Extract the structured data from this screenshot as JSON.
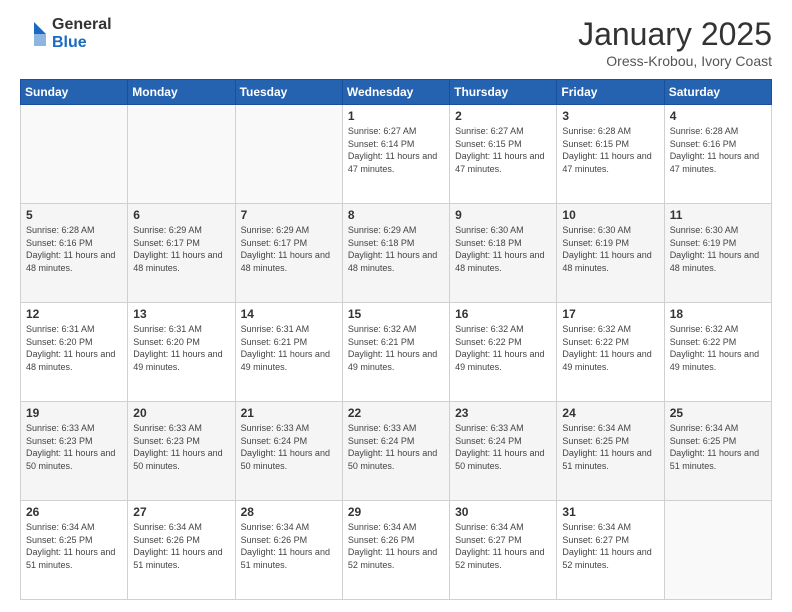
{
  "header": {
    "logo_general": "General",
    "logo_blue": "Blue",
    "title": "January 2025",
    "location": "Oress-Krobou, Ivory Coast"
  },
  "days_of_week": [
    "Sunday",
    "Monday",
    "Tuesday",
    "Wednesday",
    "Thursday",
    "Friday",
    "Saturday"
  ],
  "weeks": [
    [
      {
        "day": "",
        "info": ""
      },
      {
        "day": "",
        "info": ""
      },
      {
        "day": "",
        "info": ""
      },
      {
        "day": "1",
        "info": "Sunrise: 6:27 AM\nSunset: 6:14 PM\nDaylight: 11 hours and 47 minutes."
      },
      {
        "day": "2",
        "info": "Sunrise: 6:27 AM\nSunset: 6:15 PM\nDaylight: 11 hours and 47 minutes."
      },
      {
        "day": "3",
        "info": "Sunrise: 6:28 AM\nSunset: 6:15 PM\nDaylight: 11 hours and 47 minutes."
      },
      {
        "day": "4",
        "info": "Sunrise: 6:28 AM\nSunset: 6:16 PM\nDaylight: 11 hours and 47 minutes."
      }
    ],
    [
      {
        "day": "5",
        "info": "Sunrise: 6:28 AM\nSunset: 6:16 PM\nDaylight: 11 hours and 48 minutes."
      },
      {
        "day": "6",
        "info": "Sunrise: 6:29 AM\nSunset: 6:17 PM\nDaylight: 11 hours and 48 minutes."
      },
      {
        "day": "7",
        "info": "Sunrise: 6:29 AM\nSunset: 6:17 PM\nDaylight: 11 hours and 48 minutes."
      },
      {
        "day": "8",
        "info": "Sunrise: 6:29 AM\nSunset: 6:18 PM\nDaylight: 11 hours and 48 minutes."
      },
      {
        "day": "9",
        "info": "Sunrise: 6:30 AM\nSunset: 6:18 PM\nDaylight: 11 hours and 48 minutes."
      },
      {
        "day": "10",
        "info": "Sunrise: 6:30 AM\nSunset: 6:19 PM\nDaylight: 11 hours and 48 minutes."
      },
      {
        "day": "11",
        "info": "Sunrise: 6:30 AM\nSunset: 6:19 PM\nDaylight: 11 hours and 48 minutes."
      }
    ],
    [
      {
        "day": "12",
        "info": "Sunrise: 6:31 AM\nSunset: 6:20 PM\nDaylight: 11 hours and 48 minutes."
      },
      {
        "day": "13",
        "info": "Sunrise: 6:31 AM\nSunset: 6:20 PM\nDaylight: 11 hours and 49 minutes."
      },
      {
        "day": "14",
        "info": "Sunrise: 6:31 AM\nSunset: 6:21 PM\nDaylight: 11 hours and 49 minutes."
      },
      {
        "day": "15",
        "info": "Sunrise: 6:32 AM\nSunset: 6:21 PM\nDaylight: 11 hours and 49 minutes."
      },
      {
        "day": "16",
        "info": "Sunrise: 6:32 AM\nSunset: 6:22 PM\nDaylight: 11 hours and 49 minutes."
      },
      {
        "day": "17",
        "info": "Sunrise: 6:32 AM\nSunset: 6:22 PM\nDaylight: 11 hours and 49 minutes."
      },
      {
        "day": "18",
        "info": "Sunrise: 6:32 AM\nSunset: 6:22 PM\nDaylight: 11 hours and 49 minutes."
      }
    ],
    [
      {
        "day": "19",
        "info": "Sunrise: 6:33 AM\nSunset: 6:23 PM\nDaylight: 11 hours and 50 minutes."
      },
      {
        "day": "20",
        "info": "Sunrise: 6:33 AM\nSunset: 6:23 PM\nDaylight: 11 hours and 50 minutes."
      },
      {
        "day": "21",
        "info": "Sunrise: 6:33 AM\nSunset: 6:24 PM\nDaylight: 11 hours and 50 minutes."
      },
      {
        "day": "22",
        "info": "Sunrise: 6:33 AM\nSunset: 6:24 PM\nDaylight: 11 hours and 50 minutes."
      },
      {
        "day": "23",
        "info": "Sunrise: 6:33 AM\nSunset: 6:24 PM\nDaylight: 11 hours and 50 minutes."
      },
      {
        "day": "24",
        "info": "Sunrise: 6:34 AM\nSunset: 6:25 PM\nDaylight: 11 hours and 51 minutes."
      },
      {
        "day": "25",
        "info": "Sunrise: 6:34 AM\nSunset: 6:25 PM\nDaylight: 11 hours and 51 minutes."
      }
    ],
    [
      {
        "day": "26",
        "info": "Sunrise: 6:34 AM\nSunset: 6:25 PM\nDaylight: 11 hours and 51 minutes."
      },
      {
        "day": "27",
        "info": "Sunrise: 6:34 AM\nSunset: 6:26 PM\nDaylight: 11 hours and 51 minutes."
      },
      {
        "day": "28",
        "info": "Sunrise: 6:34 AM\nSunset: 6:26 PM\nDaylight: 11 hours and 51 minutes."
      },
      {
        "day": "29",
        "info": "Sunrise: 6:34 AM\nSunset: 6:26 PM\nDaylight: 11 hours and 52 minutes."
      },
      {
        "day": "30",
        "info": "Sunrise: 6:34 AM\nSunset: 6:27 PM\nDaylight: 11 hours and 52 minutes."
      },
      {
        "day": "31",
        "info": "Sunrise: 6:34 AM\nSunset: 6:27 PM\nDaylight: 11 hours and 52 minutes."
      },
      {
        "day": "",
        "info": ""
      }
    ]
  ]
}
